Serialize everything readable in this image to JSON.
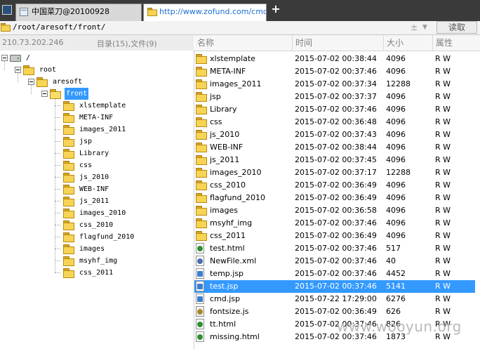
{
  "tabs": [
    {
      "label": "中国菜刀@20100928",
      "active": false
    },
    {
      "label": "http://www.zofund.com/cmd....",
      "active": true
    }
  ],
  "path_bar": {
    "path": "/root/aresoft/front/",
    "pm_symbol": "±",
    "dropdown_symbol": "▼",
    "read_button": "读取"
  },
  "info": {
    "ip": "210.73.202.246",
    "summary": "目录(15),文件(9)"
  },
  "list_headers": {
    "name": "名称",
    "time": "时间",
    "size": "大小",
    "attr": "属性"
  },
  "tree": [
    {
      "label": "/",
      "icon": "drive-icon"
    },
    {
      "label": "root",
      "icon": "folder-icon"
    },
    {
      "label": "aresoft",
      "icon": "folder-icon"
    },
    {
      "label": "front",
      "icon": "folder-open-icon",
      "selected": true
    },
    {
      "label": "xlstemplate",
      "icon": "folder-icon"
    },
    {
      "label": "META-INF",
      "icon": "folder-icon"
    },
    {
      "label": "images_2011",
      "icon": "folder-icon"
    },
    {
      "label": "jsp",
      "icon": "folder-icon"
    },
    {
      "label": "Library",
      "icon": "folder-icon"
    },
    {
      "label": "css",
      "icon": "folder-icon"
    },
    {
      "label": "js_2010",
      "icon": "folder-icon"
    },
    {
      "label": "WEB-INF",
      "icon": "folder-icon"
    },
    {
      "label": "js_2011",
      "icon": "folder-icon"
    },
    {
      "label": "images_2010",
      "icon": "folder-icon"
    },
    {
      "label": "css_2010",
      "icon": "folder-icon"
    },
    {
      "label": "flagfund_2010",
      "icon": "folder-icon"
    },
    {
      "label": "images",
      "icon": "folder-icon"
    },
    {
      "label": "msyhf_img",
      "icon": "folder-icon"
    },
    {
      "label": "css_2011",
      "icon": "folder-icon"
    }
  ],
  "files": [
    {
      "name": "xlstemplate",
      "time": "2015-07-02 00:38:44",
      "size": "4096",
      "attr": "R W",
      "icon": "folder-icon"
    },
    {
      "name": "META-INF",
      "time": "2015-07-02 00:37:46",
      "size": "4096",
      "attr": "R W",
      "icon": "folder-icon"
    },
    {
      "name": "images_2011",
      "time": "2015-07-02 00:37:34",
      "size": "12288",
      "attr": "R W",
      "icon": "folder-icon"
    },
    {
      "name": "jsp",
      "time": "2015-07-02 00:37:37",
      "size": "4096",
      "attr": "R W",
      "icon": "folder-icon"
    },
    {
      "name": "Library",
      "time": "2015-07-02 00:37:46",
      "size": "4096",
      "attr": "R W",
      "icon": "folder-icon"
    },
    {
      "name": "css",
      "time": "2015-07-02 00:36:48",
      "size": "4096",
      "attr": "R W",
      "icon": "folder-icon"
    },
    {
      "name": "js_2010",
      "time": "2015-07-02 00:37:43",
      "size": "4096",
      "attr": "R W",
      "icon": "folder-icon"
    },
    {
      "name": "WEB-INF",
      "time": "2015-07-02 00:38:44",
      "size": "4096",
      "attr": "R W",
      "icon": "folder-icon"
    },
    {
      "name": "js_2011",
      "time": "2015-07-02 00:37:45",
      "size": "4096",
      "attr": "R W",
      "icon": "folder-icon"
    },
    {
      "name": "images_2010",
      "time": "2015-07-02 00:37:17",
      "size": "12288",
      "attr": "R W",
      "icon": "folder-icon"
    },
    {
      "name": "css_2010",
      "time": "2015-07-02 00:36:49",
      "size": "4096",
      "attr": "R W",
      "icon": "folder-icon"
    },
    {
      "name": "flagfund_2010",
      "time": "2015-07-02 00:36:49",
      "size": "4096",
      "attr": "R W",
      "icon": "folder-icon"
    },
    {
      "name": "images",
      "time": "2015-07-02 00:36:58",
      "size": "4096",
      "attr": "R W",
      "icon": "folder-icon"
    },
    {
      "name": "msyhf_img",
      "time": "2015-07-02 00:37:46",
      "size": "4096",
      "attr": "R W",
      "icon": "folder-icon"
    },
    {
      "name": "css_2011",
      "time": "2015-07-02 00:36:49",
      "size": "4096",
      "attr": "R W",
      "icon": "folder-icon"
    },
    {
      "name": "test.html",
      "time": "2015-07-02 00:37:46",
      "size": "517",
      "attr": "R W",
      "icon": "html-file-icon"
    },
    {
      "name": "NewFile.xml",
      "time": "2015-07-02 00:37:46",
      "size": "40",
      "attr": "R W",
      "icon": "xml-file-icon"
    },
    {
      "name": "temp.jsp",
      "time": "2015-07-02 00:37:46",
      "size": "4452",
      "attr": "R W",
      "icon": "jsp-file-icon"
    },
    {
      "name": "test.jsp",
      "time": "2015-07-02 00:37:46",
      "size": "5141",
      "attr": "R W",
      "icon": "jsp-file-icon",
      "selected": true
    },
    {
      "name": "cmd.jsp",
      "time": "2015-07-22 17:29:00",
      "size": "6276",
      "attr": "R W",
      "icon": "jsp-file-icon"
    },
    {
      "name": "fontsize.js",
      "time": "2015-07-02 00:36:49",
      "size": "626",
      "attr": "R W",
      "icon": "js-file-icon"
    },
    {
      "name": "tt.html",
      "time": "2015-07-02 00:37:46",
      "size": "826",
      "attr": "R W",
      "icon": "html-file-icon"
    },
    {
      "name": "missing.html",
      "time": "2015-07-02 00:37:46",
      "size": "1873",
      "attr": "R W",
      "icon": "html-file-icon"
    }
  ],
  "watermark": "www.wooyun.org",
  "colors": {
    "selection": "#3399ff",
    "tab_bar": "#3a3a3a",
    "link_tab_text": "#1b6fd3",
    "folder": "#f7d454"
  }
}
